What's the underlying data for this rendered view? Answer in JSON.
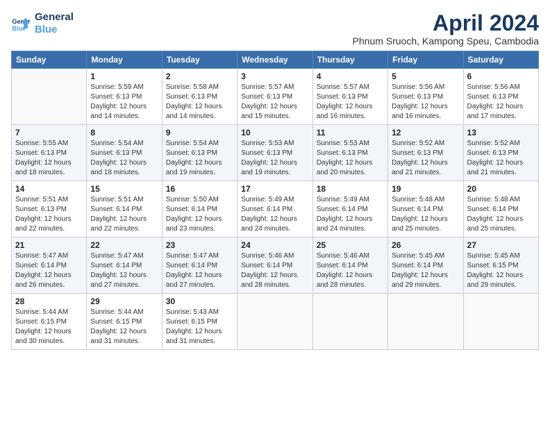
{
  "header": {
    "logo_line1": "General",
    "logo_line2": "Blue",
    "month_year": "April 2024",
    "location": "Phnum Sruoch, Kampong Speu, Cambodia"
  },
  "days_of_week": [
    "Sunday",
    "Monday",
    "Tuesday",
    "Wednesday",
    "Thursday",
    "Friday",
    "Saturday"
  ],
  "weeks": [
    [
      {
        "day": "",
        "info": ""
      },
      {
        "day": "1",
        "info": "Sunrise: 5:59 AM\nSunset: 6:13 PM\nDaylight: 12 hours\nand 14 minutes."
      },
      {
        "day": "2",
        "info": "Sunrise: 5:58 AM\nSunset: 6:13 PM\nDaylight: 12 hours\nand 14 minutes."
      },
      {
        "day": "3",
        "info": "Sunrise: 5:57 AM\nSunset: 6:13 PM\nDaylight: 12 hours\nand 15 minutes."
      },
      {
        "day": "4",
        "info": "Sunrise: 5:57 AM\nSunset: 6:13 PM\nDaylight: 12 hours\nand 16 minutes."
      },
      {
        "day": "5",
        "info": "Sunrise: 5:56 AM\nSunset: 6:13 PM\nDaylight: 12 hours\nand 16 minutes."
      },
      {
        "day": "6",
        "info": "Sunrise: 5:56 AM\nSunset: 6:13 PM\nDaylight: 12 hours\nand 17 minutes."
      }
    ],
    [
      {
        "day": "7",
        "info": "Sunrise: 5:55 AM\nSunset: 6:13 PM\nDaylight: 12 hours\nand 18 minutes."
      },
      {
        "day": "8",
        "info": "Sunrise: 5:54 AM\nSunset: 6:13 PM\nDaylight: 12 hours\nand 18 minutes."
      },
      {
        "day": "9",
        "info": "Sunrise: 5:54 AM\nSunset: 6:13 PM\nDaylight: 12 hours\nand 19 minutes."
      },
      {
        "day": "10",
        "info": "Sunrise: 5:53 AM\nSunset: 6:13 PM\nDaylight: 12 hours\nand 19 minutes."
      },
      {
        "day": "11",
        "info": "Sunrise: 5:53 AM\nSunset: 6:13 PM\nDaylight: 12 hours\nand 20 minutes."
      },
      {
        "day": "12",
        "info": "Sunrise: 5:52 AM\nSunset: 6:13 PM\nDaylight: 12 hours\nand 21 minutes."
      },
      {
        "day": "13",
        "info": "Sunrise: 5:52 AM\nSunset: 6:13 PM\nDaylight: 12 hours\nand 21 minutes."
      }
    ],
    [
      {
        "day": "14",
        "info": "Sunrise: 5:51 AM\nSunset: 6:13 PM\nDaylight: 12 hours\nand 22 minutes."
      },
      {
        "day": "15",
        "info": "Sunrise: 5:51 AM\nSunset: 6:14 PM\nDaylight: 12 hours\nand 22 minutes."
      },
      {
        "day": "16",
        "info": "Sunrise: 5:50 AM\nSunset: 6:14 PM\nDaylight: 12 hours\nand 23 minutes."
      },
      {
        "day": "17",
        "info": "Sunrise: 5:49 AM\nSunset: 6:14 PM\nDaylight: 12 hours\nand 24 minutes."
      },
      {
        "day": "18",
        "info": "Sunrise: 5:49 AM\nSunset: 6:14 PM\nDaylight: 12 hours\nand 24 minutes."
      },
      {
        "day": "19",
        "info": "Sunrise: 5:48 AM\nSunset: 6:14 PM\nDaylight: 12 hours\nand 25 minutes."
      },
      {
        "day": "20",
        "info": "Sunrise: 5:48 AM\nSunset: 6:14 PM\nDaylight: 12 hours\nand 25 minutes."
      }
    ],
    [
      {
        "day": "21",
        "info": "Sunrise: 5:47 AM\nSunset: 6:14 PM\nDaylight: 12 hours\nand 26 minutes."
      },
      {
        "day": "22",
        "info": "Sunrise: 5:47 AM\nSunset: 6:14 PM\nDaylight: 12 hours\nand 27 minutes."
      },
      {
        "day": "23",
        "info": "Sunrise: 5:47 AM\nSunset: 6:14 PM\nDaylight: 12 hours\nand 27 minutes."
      },
      {
        "day": "24",
        "info": "Sunrise: 5:46 AM\nSunset: 6:14 PM\nDaylight: 12 hours\nand 28 minutes."
      },
      {
        "day": "25",
        "info": "Sunrise: 5:46 AM\nSunset: 6:14 PM\nDaylight: 12 hours\nand 28 minutes."
      },
      {
        "day": "26",
        "info": "Sunrise: 5:45 AM\nSunset: 6:14 PM\nDaylight: 12 hours\nand 29 minutes."
      },
      {
        "day": "27",
        "info": "Sunrise: 5:45 AM\nSunset: 6:15 PM\nDaylight: 12 hours\nand 29 minutes."
      }
    ],
    [
      {
        "day": "28",
        "info": "Sunrise: 5:44 AM\nSunset: 6:15 PM\nDaylight: 12 hours\nand 30 minutes."
      },
      {
        "day": "29",
        "info": "Sunrise: 5:44 AM\nSunset: 6:15 PM\nDaylight: 12 hours\nand 31 minutes."
      },
      {
        "day": "30",
        "info": "Sunrise: 5:43 AM\nSunset: 6:15 PM\nDaylight: 12 hours\nand 31 minutes."
      },
      {
        "day": "",
        "info": ""
      },
      {
        "day": "",
        "info": ""
      },
      {
        "day": "",
        "info": ""
      },
      {
        "day": "",
        "info": ""
      }
    ]
  ]
}
